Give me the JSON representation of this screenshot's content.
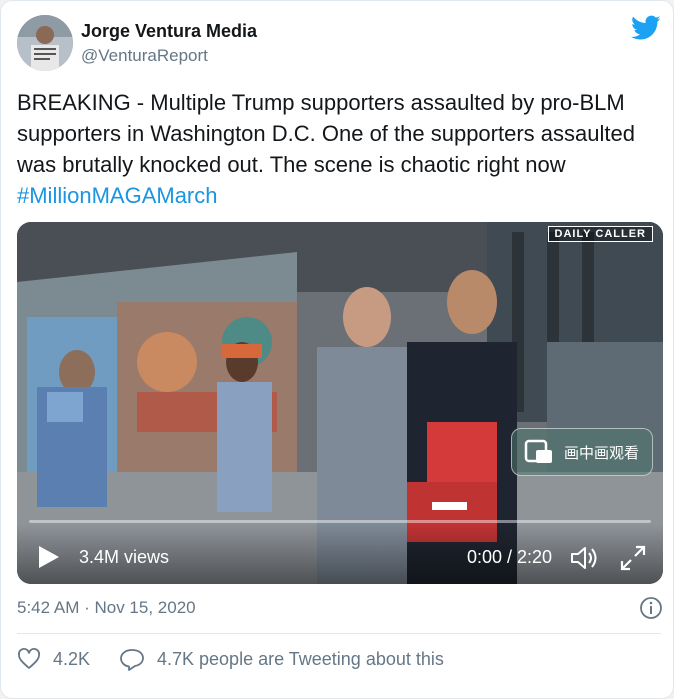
{
  "author": {
    "name": "Jorge Ventura Media",
    "handle": "@VenturaReport"
  },
  "tweet": {
    "text": "BREAKING - Multiple Trump supporters assaulted by pro-BLM supporters in Washington D.C. One of the supporters assaulted was brutally knocked out. The scene is chaotic right now ",
    "hashtag": "#MillionMAGAMarch",
    "timestamp": "5:42 AM · Nov 15, 2020"
  },
  "video": {
    "watermark": "DAILY CALLER",
    "pip_label": "画中画观看",
    "views": "3.4M views",
    "time": "0:00 / 2:20",
    "progress": 0
  },
  "footer": {
    "likes": "4.2K",
    "tweeting": "4.7K people are Tweeting about this"
  },
  "colors": {
    "brand": "#1da1f2",
    "hashtag": "#1b95e0",
    "secondary_text": "#657786"
  },
  "icons": [
    "twitter-bird-icon",
    "play-icon",
    "volume-icon",
    "fullscreen-icon",
    "info-icon",
    "heart-icon",
    "reply-icon",
    "pip-icon"
  ]
}
